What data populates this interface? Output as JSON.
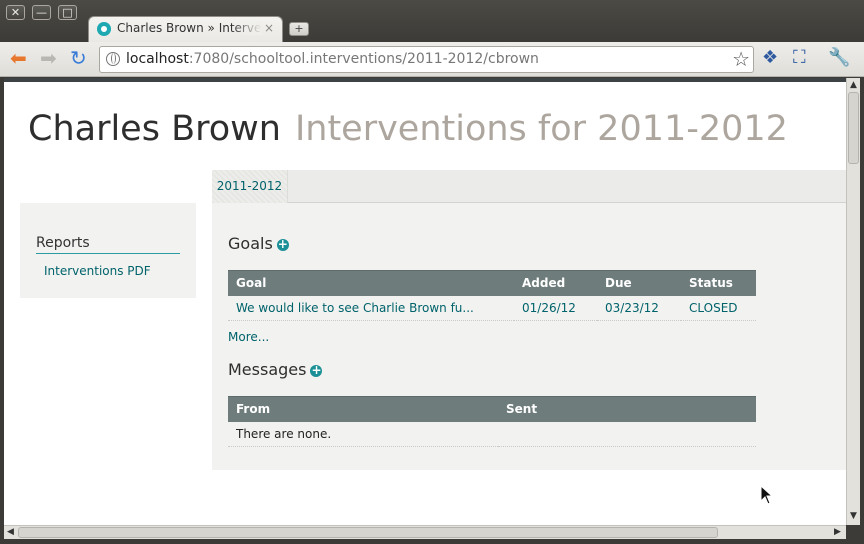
{
  "window": {
    "close_label": "✕",
    "minimize_label": "—",
    "maximize_label": "□"
  },
  "tab": {
    "title": "Charles Brown » Interventions",
    "close_label": "×",
    "new_tab_label": "+"
  },
  "toolbar": {
    "back_icon": "back-arrow-icon",
    "forward_icon": "forward-arrow-icon",
    "reload_icon": "reload-icon",
    "url_host": "localhost",
    "url_rest": ":7080/schooltool.interventions/2011-2012/cbrown"
  },
  "page": {
    "name": "Charles Brown",
    "subtitle": "Interventions for 2011-2012"
  },
  "sidebar": {
    "heading": "Reports",
    "link": "Interventions PDF"
  },
  "tabs": {
    "year": "2011-2012"
  },
  "goals": {
    "title": "Goals",
    "columns": [
      "Goal",
      "Added",
      "Due",
      "Status"
    ],
    "rows": [
      {
        "goal": "We would like to see Charlie Brown fu...",
        "added": "01/26/12",
        "due": "03/23/12",
        "status": "CLOSED"
      }
    ],
    "more_label": "More..."
  },
  "messages": {
    "title": "Messages",
    "columns": [
      "From",
      "Sent"
    ],
    "empty_text": "There are none."
  },
  "colors": {
    "accent": "#1b9097",
    "link": "#00636b",
    "table_header": "#6e7c7b"
  }
}
